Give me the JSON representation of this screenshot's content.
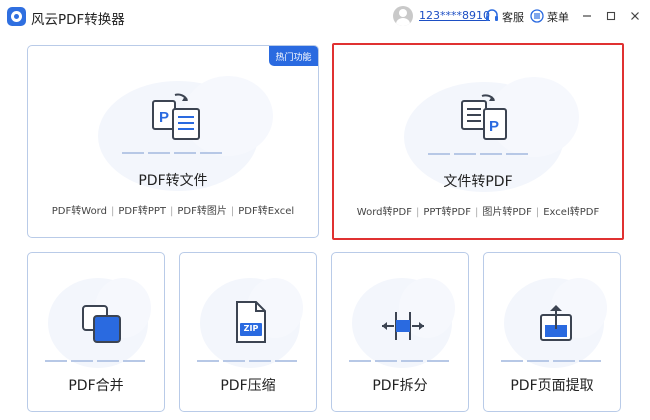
{
  "app": {
    "title": "风云PDF转换器"
  },
  "header": {
    "user_phone": "123****8910",
    "service_label": "客服",
    "menu_label": "菜单"
  },
  "cards": {
    "pdf_to_file": {
      "title": "PDF转文件",
      "badge": "热门功能",
      "subs": [
        "PDF转Word",
        "PDF转PPT",
        "PDF转图片",
        "PDF转Excel"
      ],
      "sep": "|"
    },
    "file_to_pdf": {
      "title": "文件转PDF",
      "subs": [
        "Word转PDF",
        "PPT转PDF",
        "图片转PDF",
        "Excel转PDF"
      ],
      "sep": "|"
    },
    "merge": {
      "title": "PDF合并",
      "icon_text": ""
    },
    "compress": {
      "title": "PDF压缩",
      "icon_text": "ZIP"
    },
    "split": {
      "title": "PDF拆分"
    },
    "extract": {
      "title": "PDF页面提取"
    }
  },
  "colors": {
    "accent": "#2a6ae0",
    "selected_border": "#e03131",
    "card_border": "#b9cbe8",
    "icon_dark": "#3c4452"
  },
  "icons": {
    "pdf_to_file": "pdf-to-file-icon",
    "file_to_pdf": "file-to-pdf-icon",
    "merge": "merge-icon",
    "compress": "zip-icon",
    "split": "split-icon",
    "extract": "extract-icon"
  }
}
